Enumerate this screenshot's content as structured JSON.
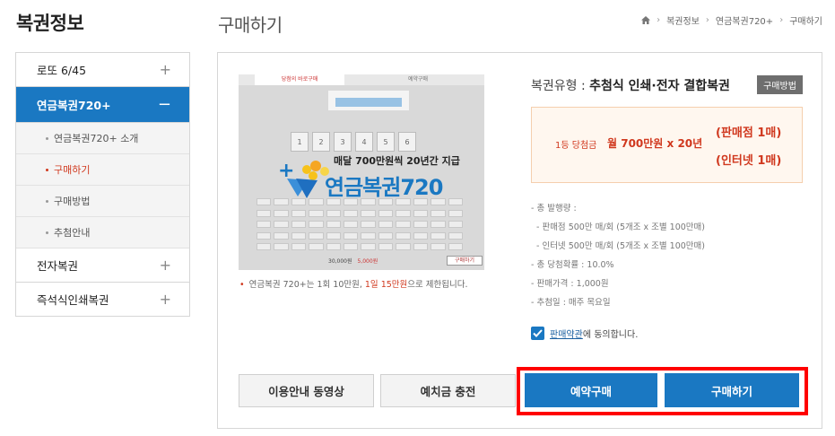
{
  "sidebar": {
    "title": "복권정보",
    "menus": [
      {
        "label": "로또 6/45",
        "icon": "+"
      },
      {
        "label": "연금복권720+",
        "icon": "−"
      },
      {
        "label": "전자복권",
        "icon": "+"
      },
      {
        "label": "즉석식인쇄복권",
        "icon": "+"
      }
    ],
    "subitems": [
      {
        "label": "연금복권720+ 소개"
      },
      {
        "label": "구매하기"
      },
      {
        "label": "구매방법"
      },
      {
        "label": "추첨안내"
      }
    ]
  },
  "header": {
    "page_title": "구매하기",
    "breadcrumb": [
      "복권정보",
      "연금복권720+",
      "구매하기"
    ]
  },
  "preview": {
    "tab_direct": "당첨의 바로구매",
    "tab_reserve": "예약구매",
    "overlay_tagline": "매달 700만원씩 20년간 지급",
    "overlay_logo": "연금복권720",
    "numbers": [
      "1",
      "2",
      "3",
      "4",
      "5",
      "6"
    ],
    "total_label": "30,000원",
    "pay_label": "5,000원",
    "buy_small": "구매하기"
  },
  "note": {
    "prefix": "연금복권 720+는 1회 10만원, ",
    "highlight": "1일 15만원",
    "suffix": "으로 제한됩니다."
  },
  "info": {
    "type_label": "복권유형",
    "type_value": "추첨식 인쇄·전자 결합복권",
    "method_button": "구매방법",
    "prize": {
      "rank": "1등 당첨금",
      "amount": "월 700만원 x 20년",
      "channel1": "(판매점 1매)",
      "channel2": "(인터넷 1매)"
    },
    "specs": {
      "issue_label": "- 총 발행량 :",
      "issue_store": "- 판매점 500만 매/회 (5개조 x 조별 100만매)",
      "issue_online": "- 인터넷 500만 매/회 (5개조 x 조별 100만매)",
      "odds": "- 총 당첨확률 : 10.0%",
      "price": "- 판매가격 : 1,000원",
      "draw": "- 추첨일 : 매주 목요일"
    },
    "agree_link": "판매약관",
    "agree_text": "에 동의합니다."
  },
  "buttons": {
    "video": "이용안내 동영상",
    "deposit": "예치금 충전",
    "reserve": "예약구매",
    "buy": "구매하기"
  },
  "colors": {
    "primary": "#1a78c2",
    "accent": "#d0381e",
    "highlight_frame": "#ff0000"
  }
}
